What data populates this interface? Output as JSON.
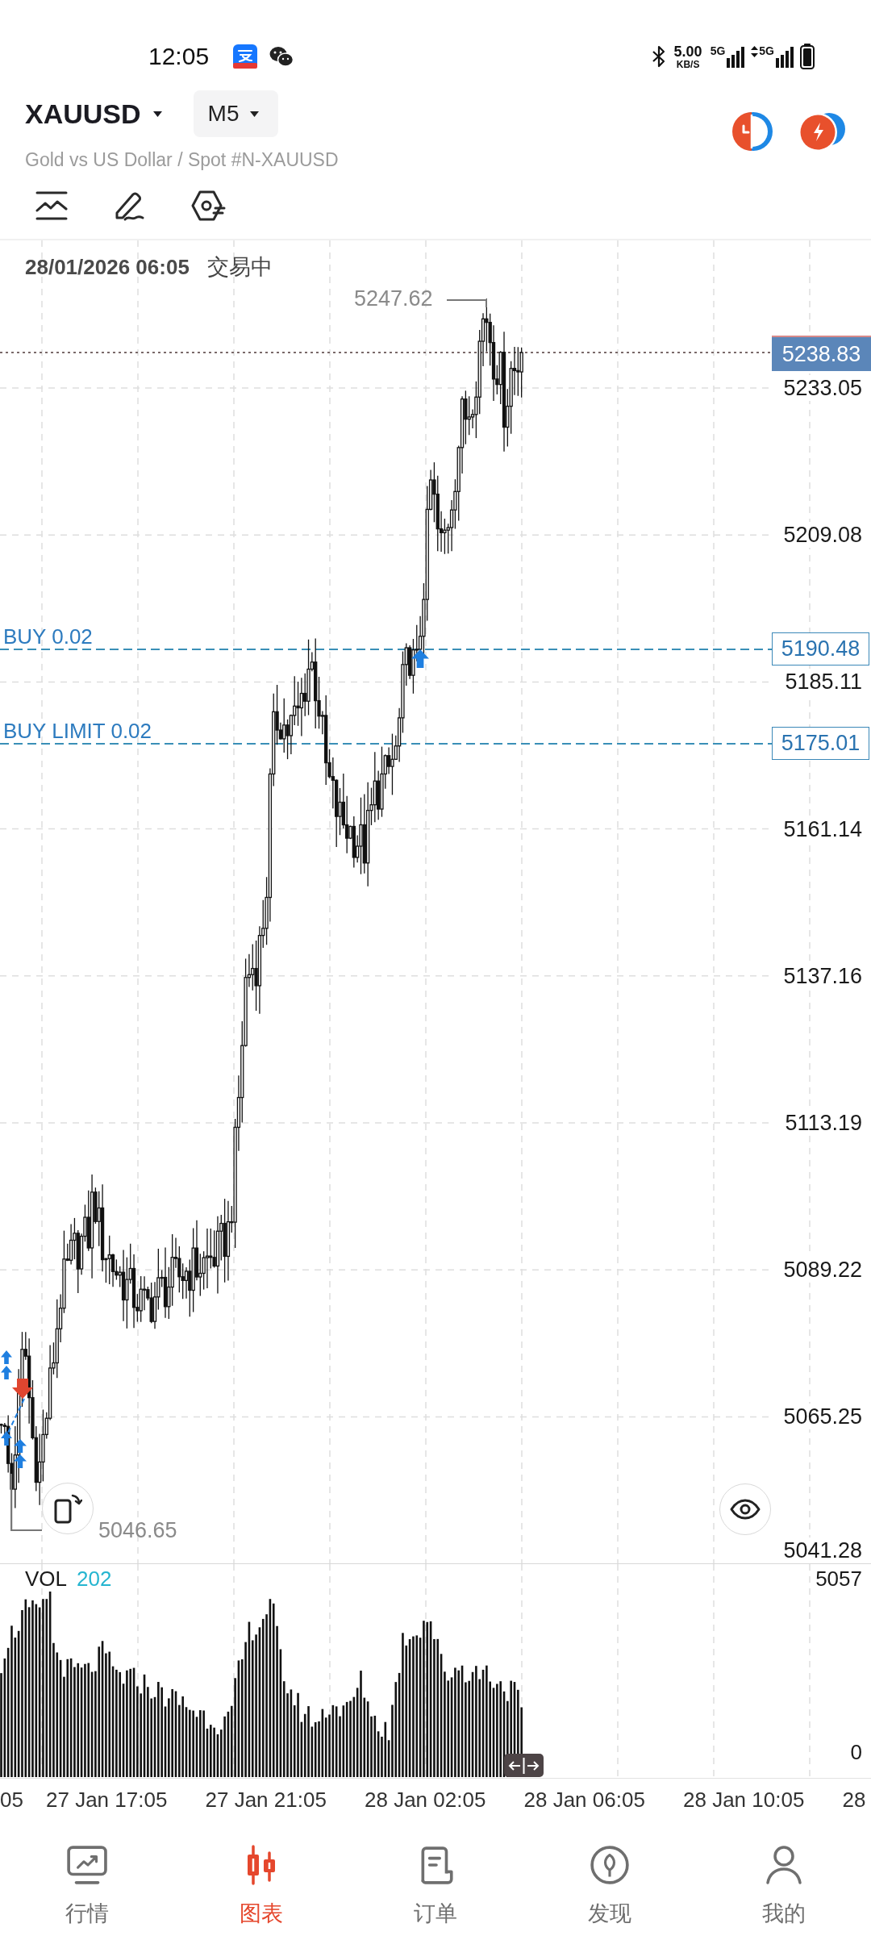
{
  "status_bar": {
    "time": "12:05",
    "speed": "5.00",
    "speed_unit": "KB/S",
    "sim1_network": "5G",
    "sim2_network": "5G"
  },
  "header": {
    "symbol": "XAUUSD",
    "timeframe": "M5",
    "description": "Gold vs US Dollar / Spot #N-XAUUSD"
  },
  "chart": {
    "datetime": "28/01/2026 06:05",
    "market_status": "交易中",
    "price_axis": [
      "5233.05",
      "5209.08",
      "5185.11",
      "5161.14",
      "5137.16",
      "5113.19",
      "5089.22",
      "5065.25",
      "5041.28"
    ],
    "current_price": "5238.83",
    "high": "5247.62",
    "low": "5046.65",
    "orders": [
      {
        "label": "BUY 0.02",
        "price": "5190.48"
      },
      {
        "label": "BUY LIMIT 0.02",
        "price": "5175.01"
      }
    ]
  },
  "volume": {
    "label": "VOL",
    "value": "202",
    "axis_max": "5057",
    "axis_min": "0"
  },
  "time_axis": [
    "05",
    "27 Jan 17:05",
    "27 Jan 21:05",
    "28 Jan 02:05",
    "28 Jan 06:05",
    "28 Jan 10:05",
    "28"
  ],
  "bottom_nav": [
    {
      "label": "行情",
      "selected": false
    },
    {
      "label": "图表",
      "selected": true
    },
    {
      "label": "订单",
      "selected": false
    },
    {
      "label": "发现",
      "selected": false
    },
    {
      "label": "我的",
      "selected": false
    }
  ]
}
